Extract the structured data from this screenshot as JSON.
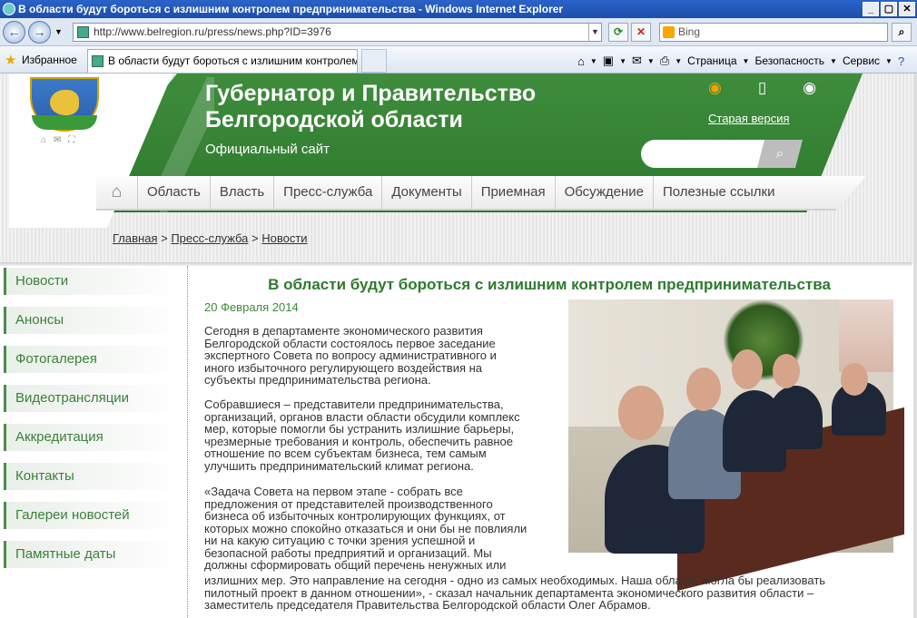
{
  "window": {
    "title": "В области будут бороться с излишним контролем предпринимательства - Windows Internet Explorer"
  },
  "browser": {
    "url": "http://www.belregion.ru/press/news.php?ID=3976",
    "search_placeholder": "Bing",
    "favorites_label": "Избранное",
    "tab_title": "В области будут бороться с излишним контролем ...",
    "menu": [
      "Страница",
      "Безопасность",
      "Сервис"
    ]
  },
  "site": {
    "title": "Губернатор и Правительство Белгородской области",
    "subtitle": "Официальный сайт",
    "old_version": "Старая версия",
    "nav": [
      "Область",
      "Власть",
      "Пресс-служба",
      "Документы",
      "Приемная",
      "Обсуждение",
      "Полезные ссылки"
    ],
    "breadcrumb": [
      "Главная",
      "Пресс-служба",
      "Новости"
    ],
    "sidebar": [
      "Новости",
      "Анонсы",
      "Фотогалерея",
      "Видеотрансляции",
      "Аккредитация",
      "Контакты",
      "Галереи новостей",
      "Памятные даты"
    ]
  },
  "article": {
    "title": "В области будут бороться с излишним контролем предпринимательства",
    "date": "20 Февраля 2014",
    "p1": [
      "Сегодня в департаменте экономического развития",
      "Белгородской области состоялось первое заседание",
      "экспертного Совета по вопросу административного и",
      "иного избыточного регулирующего воздействия на",
      "субъекты предпринимательства региона."
    ],
    "p2": [
      "Собравшиеся – представители предпринимательства,",
      "организаций, органов власти области обсудили комплекс",
      "мер, которые помогли бы устранить излишние барьеры,",
      "чрезмерные требования и контроль, обеспечить равное",
      "отношение по всем субъектам бизнеса, тем самым",
      "улучшить предпринимательский климат региона."
    ],
    "p3": [
      "«Задача Совета на первом этапе - собрать все",
      "предложения от представителей производственного",
      "бизнеса об избыточных контролирующих функциях, от",
      "которых можно спокойно отказаться и они бы не повлияли",
      "ни на какую ситуацию с точки зрения успешной и",
      "безопасной работы предприятий и организаций. Мы",
      "должны сформировать общий перечень ненужных или"
    ],
    "p3_wide": [
      "излишних мер. Это направление на сегодня - одно из самых необходимых. Наша область могла бы реализовать",
      "пилотный проект в данном отношении», - сказал начальник департамента экономического развития области –",
      "заместитель председателя Правительства Белгородской области Олег Абрамов."
    ]
  }
}
